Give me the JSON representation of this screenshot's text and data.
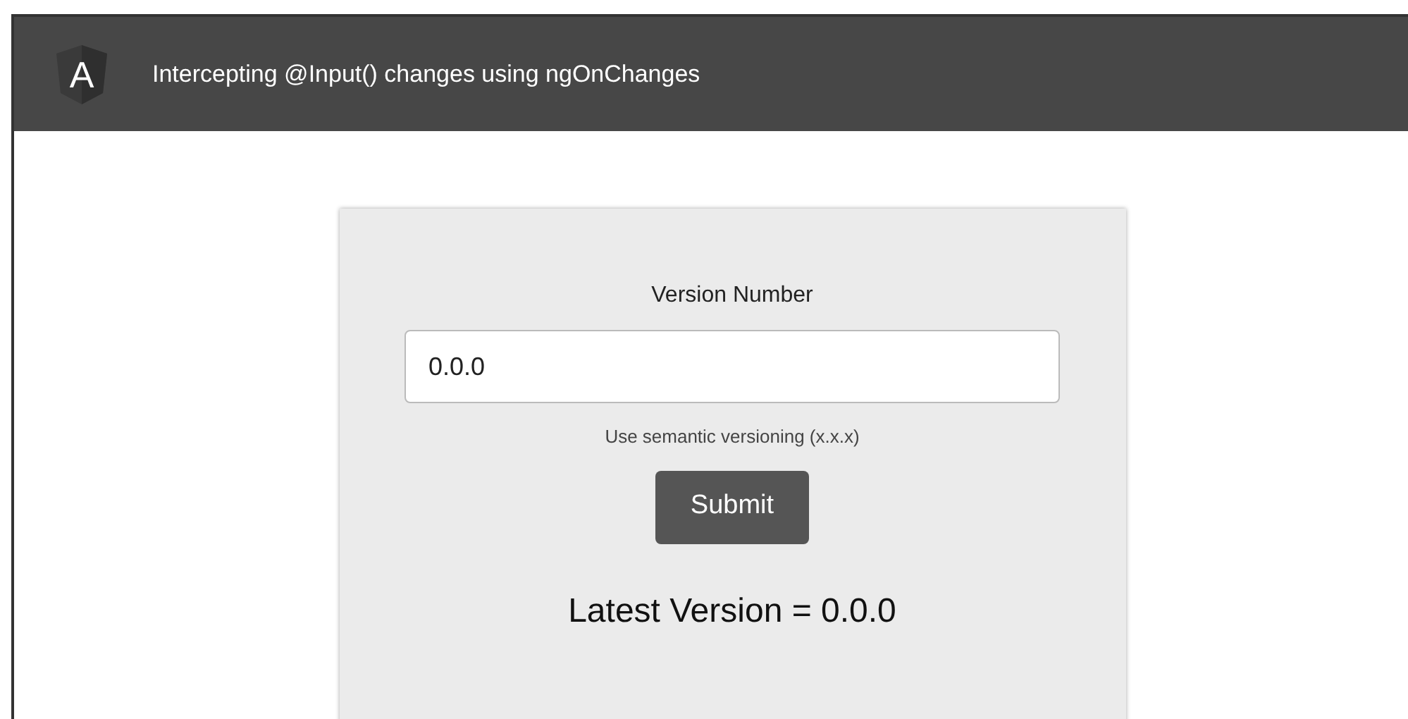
{
  "header": {
    "logo_letter": "A",
    "title": "Intercepting @Input() changes using ngOnChanges"
  },
  "form": {
    "label": "Version Number",
    "value": "0.0.0",
    "hint": "Use semantic versioning (x.x.x)",
    "button": "Submit"
  },
  "result": "Latest Version = 0.0.0"
}
